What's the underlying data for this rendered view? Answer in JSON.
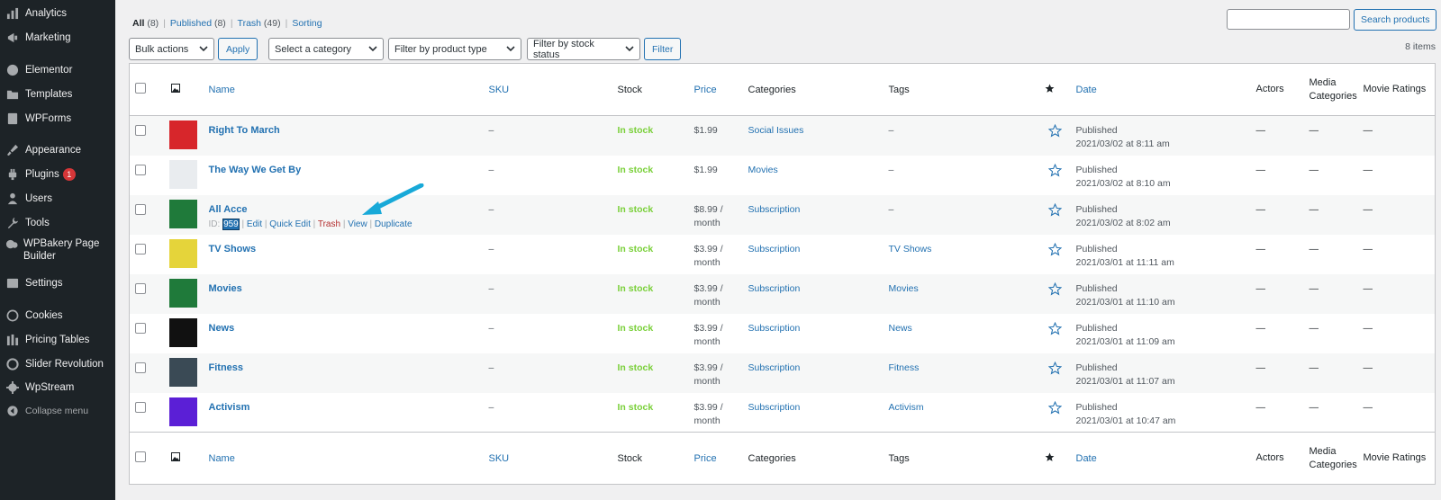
{
  "sidebar": {
    "items": [
      {
        "label": "Analytics",
        "icon": "bar-chart-icon"
      },
      {
        "label": "Marketing",
        "icon": "megaphone-icon"
      },
      {
        "label": "Elementor",
        "icon": "elementor-icon"
      },
      {
        "label": "Templates",
        "icon": "folder-icon"
      },
      {
        "label": "WPForms",
        "icon": "forms-icon"
      },
      {
        "label": "Appearance",
        "icon": "paintbrush-icon"
      },
      {
        "label": "Plugins",
        "icon": "plugin-icon",
        "badge": "1"
      },
      {
        "label": "Users",
        "icon": "users-icon"
      },
      {
        "label": "Tools",
        "icon": "wrench-icon"
      },
      {
        "label": "WPBakery Page Builder",
        "icon": "wpbakery-icon"
      },
      {
        "label": "Settings",
        "icon": "sliders-icon"
      },
      {
        "label": "Cookies",
        "icon": "cookie-icon"
      },
      {
        "label": "Pricing Tables",
        "icon": "pricing-table-icon"
      },
      {
        "label": "Slider Revolution",
        "icon": "slider-revolution-icon"
      },
      {
        "label": "WpStream",
        "icon": "gear-icon"
      },
      {
        "label": "Collapse menu",
        "icon": "collapse-arrow-icon"
      }
    ]
  },
  "filters": {
    "all": "All",
    "all_count": "(8)",
    "published": "Published",
    "published_count": "(8)",
    "trash": "Trash",
    "trash_count": "(49)",
    "sorting": "Sorting",
    "sep": "|"
  },
  "search": {
    "placeholder": "",
    "button": "Search products"
  },
  "toolbar": {
    "bulk_actions": "Bulk actions",
    "apply": "Apply",
    "category": "Select a category",
    "product_type": "Filter by product type",
    "stock_status": "Filter by stock status",
    "filter": "Filter",
    "items_count": "8 items"
  },
  "columns": {
    "name": "Name",
    "sku": "SKU",
    "stock": "Stock",
    "price": "Price",
    "categories": "Categories",
    "tags": "Tags",
    "date": "Date",
    "actors": "Actors",
    "media_categories": "Media Categories",
    "movie_ratings": "Movie Ratings"
  },
  "row_actions": {
    "id_prefix": "ID: ",
    "id_value": "959",
    "edit": "Edit",
    "quick_edit": "Quick Edit",
    "trash": "Trash",
    "view": "View",
    "duplicate": "Duplicate",
    "sep": " | "
  },
  "products": [
    {
      "name": "Right To March",
      "sku": "–",
      "stock": "In stock",
      "price": "$1.99",
      "category": "Social Issues",
      "tags": "–",
      "status": "Published",
      "date": "2021/03/02 at 8:11 am",
      "actors": "—",
      "media": "—",
      "ratings": "—",
      "thumb_color": "#d7262b"
    },
    {
      "name": "The Way We Get By",
      "sku": "–",
      "stock": "In stock",
      "price": "$1.99",
      "category": "Movies",
      "tags": "–",
      "status": "Published",
      "date": "2021/03/02 at 8:10 am",
      "actors": "—",
      "media": "—",
      "ratings": "—",
      "thumb_color": "#e9ecef"
    },
    {
      "name": "All Acce",
      "sku": "–",
      "stock": "In stock",
      "price": "$8.99 / month",
      "category": "Subscription",
      "tags": "–",
      "status": "Published",
      "date": "2021/03/02 at 8:02 am",
      "actors": "—",
      "media": "—",
      "ratings": "—",
      "thumb_color": "#1f7a3a"
    },
    {
      "name": "TV Shows",
      "sku": "–",
      "stock": "In stock",
      "price": "$3.99 / month",
      "category": "Subscription",
      "tags": "TV Shows",
      "status": "Published",
      "date": "2021/03/01 at 11:11 am",
      "actors": "—",
      "media": "—",
      "ratings": "—",
      "thumb_color": "#e5d43a"
    },
    {
      "name": "Movies",
      "sku": "–",
      "stock": "In stock",
      "price": "$3.99 / month",
      "category": "Subscription",
      "tags": "Movies",
      "status": "Published",
      "date": "2021/03/01 at 11:10 am",
      "actors": "—",
      "media": "—",
      "ratings": "—",
      "thumb_color": "#1f7a3a"
    },
    {
      "name": "News",
      "sku": "–",
      "stock": "In stock",
      "price": "$3.99 / month",
      "category": "Subscription",
      "tags": "News",
      "status": "Published",
      "date": "2021/03/01 at 11:09 am",
      "actors": "—",
      "media": "—",
      "ratings": "—",
      "thumb_color": "#111111"
    },
    {
      "name": "Fitness",
      "sku": "–",
      "stock": "In stock",
      "price": "$3.99 / month",
      "category": "Subscription",
      "tags": "Fitness",
      "status": "Published",
      "date": "2021/03/01 at 11:07 am",
      "actors": "—",
      "media": "—",
      "ratings": "—",
      "thumb_color": "#3a4a55"
    },
    {
      "name": "Activism",
      "sku": "–",
      "stock": "In stock",
      "price": "$3.99 / month",
      "category": "Subscription",
      "tags": "Activism",
      "status": "Published",
      "date": "2021/03/01 at 10:47 am",
      "actors": "—",
      "media": "—",
      "ratings": "—",
      "thumb_color": "#5b1fd6"
    }
  ],
  "colors": {
    "accent": "#2271b1",
    "in_stock": "#7ad03a",
    "arrow": "#18a9d8"
  }
}
